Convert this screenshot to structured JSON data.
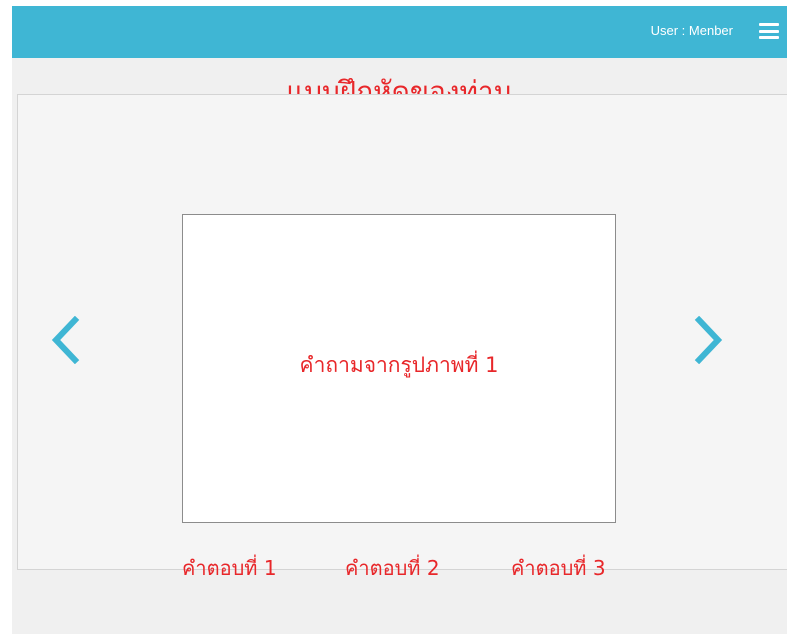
{
  "header": {
    "user_label": "User :  Menber",
    "menu_icon": "hamburger-menu-icon",
    "background_color": "#3fb6d4"
  },
  "main": {
    "title": "แบบฝึกหัดของท่าน",
    "divider_icon": "dna-icon",
    "accent_color": "#3fb6d4",
    "text_color": "#e8272a"
  },
  "quiz": {
    "question": "คำถามจากรูปภาพที่ 1",
    "prev_icon": "chevron-left-icon",
    "next_icon": "chevron-right-icon",
    "answers": [
      "คำตอบที่ 1",
      "คำตอบที่ 2",
      "คำตอบที่ 3"
    ]
  }
}
